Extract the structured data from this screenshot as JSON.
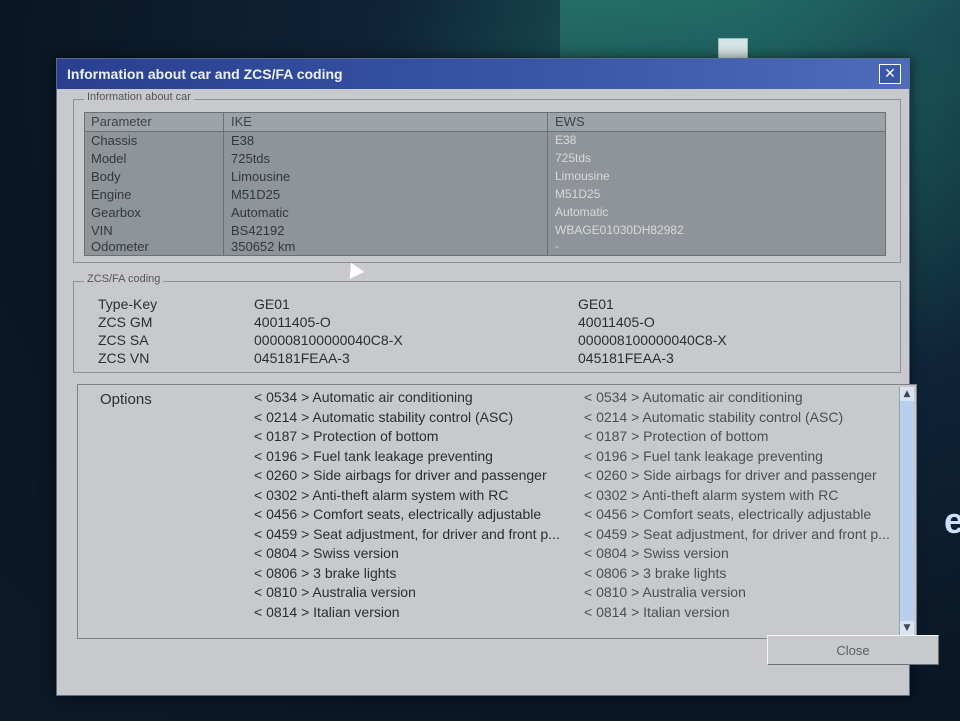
{
  "window": {
    "title": "Information about car and ZCS/FA coding",
    "close_symbol": "✕"
  },
  "info_group": {
    "label": "Information about car",
    "columns": [
      "Parameter",
      "IKE",
      "EWS"
    ],
    "rows": [
      {
        "param": "Chassis",
        "ike": "E38",
        "ews": "E38"
      },
      {
        "param": "Model",
        "ike": "725tds",
        "ews": "725tds"
      },
      {
        "param": "Body",
        "ike": "Limousine",
        "ews": "Limousine"
      },
      {
        "param": "Engine",
        "ike": "M51D25",
        "ews": "M51D25"
      },
      {
        "param": "Gearbox",
        "ike": "Automatic",
        "ews": "Automatic"
      },
      {
        "param": "VIN",
        "ike": "BS42192",
        "ews": "WBAGE01030DH82982"
      },
      {
        "param": "Odometer",
        "ike": "350652 km",
        "ews": "-"
      }
    ]
  },
  "zcs_group": {
    "label": "ZCS/FA coding",
    "rows": [
      {
        "param": "Type-Key",
        "ike": "GE01",
        "ews": "GE01"
      },
      {
        "param": "ZCS GM",
        "ike": "40011405-O",
        "ews": "40011405-O"
      },
      {
        "param": "ZCS SA",
        "ike": "000008100000040C8-X",
        "ews": "000008100000040C8-X"
      },
      {
        "param": "ZCS VN",
        "ike": "045181FEAA-3",
        "ews": "045181FEAA-3"
      }
    ]
  },
  "options": {
    "label": "Options",
    "ike": [
      "< 0534 >  Automatic air conditioning",
      "< 0214 >  Automatic stability control (ASC)",
      "< 0187 >  Protection of bottom",
      "< 0196 >  Fuel tank leakage preventing",
      "< 0260 >  Side airbags for driver and passenger",
      "< 0302 >  Anti-theft alarm system with RC",
      "< 0456 >  Comfort seats, electrically adjustable",
      "< 0459 >  Seat adjustment, for driver and front p...",
      "< 0804 >  Swiss version",
      "< 0806 >  3 brake lights",
      "< 0810 >  Australia version",
      "< 0814 >  Italian version"
    ],
    "ews": [
      "< 0534 >  Automatic air conditioning",
      "< 0214 >  Automatic stability control (ASC)",
      "< 0187 >  Protection of bottom",
      "< 0196 >  Fuel tank leakage preventing",
      "< 0260 >  Side airbags for driver and passenger",
      "< 0302 >  Anti-theft alarm system with RC",
      "< 0456 >  Comfort seats, electrically adjustable",
      "< 0459 >  Seat adjustment, for driver and front p...",
      "< 0804 >  Swiss version",
      "< 0806 >  3 brake lights",
      "< 0810 >  Australia version",
      "< 0814 >  Italian version"
    ],
    "scroll_up": "▲",
    "scroll_down": "▼"
  },
  "buttons": {
    "close": "Close"
  },
  "desktop": {
    "side_letter": "e"
  }
}
